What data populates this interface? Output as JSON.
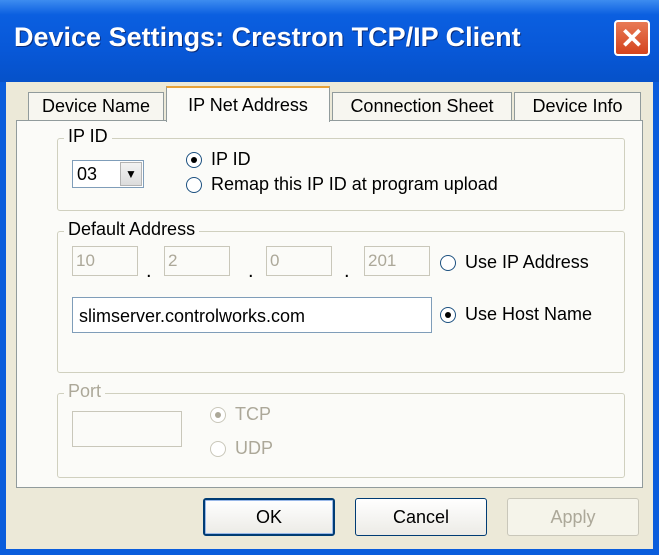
{
  "window": {
    "title": "Device Settings: Crestron TCP/IP Client",
    "close_symbol": "✕"
  },
  "tabs": [
    {
      "label": "Device Name",
      "active": false
    },
    {
      "label": "IP Net Address",
      "active": true
    },
    {
      "label": "Connection Sheet",
      "active": false
    },
    {
      "label": "Device Info",
      "active": false
    }
  ],
  "ip_id_group": {
    "legend": "IP ID",
    "combo_value": "03",
    "options": [
      {
        "label": "IP ID",
        "checked": true
      },
      {
        "label": "Remap this IP ID at program upload",
        "checked": false
      }
    ]
  },
  "default_address": {
    "legend": "Default Address",
    "octets": [
      "10",
      "2",
      "0",
      "201"
    ],
    "use_ip_label": "Use IP Address",
    "use_ip_checked": false,
    "host_name": "slimserver.controlworks.com",
    "use_host_label": "Use Host Name",
    "use_host_checked": true
  },
  "port_group": {
    "legend": "Port",
    "value": "",
    "tcp_label": "TCP",
    "udp_label": "UDP",
    "tcp_checked": true
  },
  "buttons": {
    "ok": "OK",
    "cancel": "Cancel",
    "apply": "Apply"
  }
}
